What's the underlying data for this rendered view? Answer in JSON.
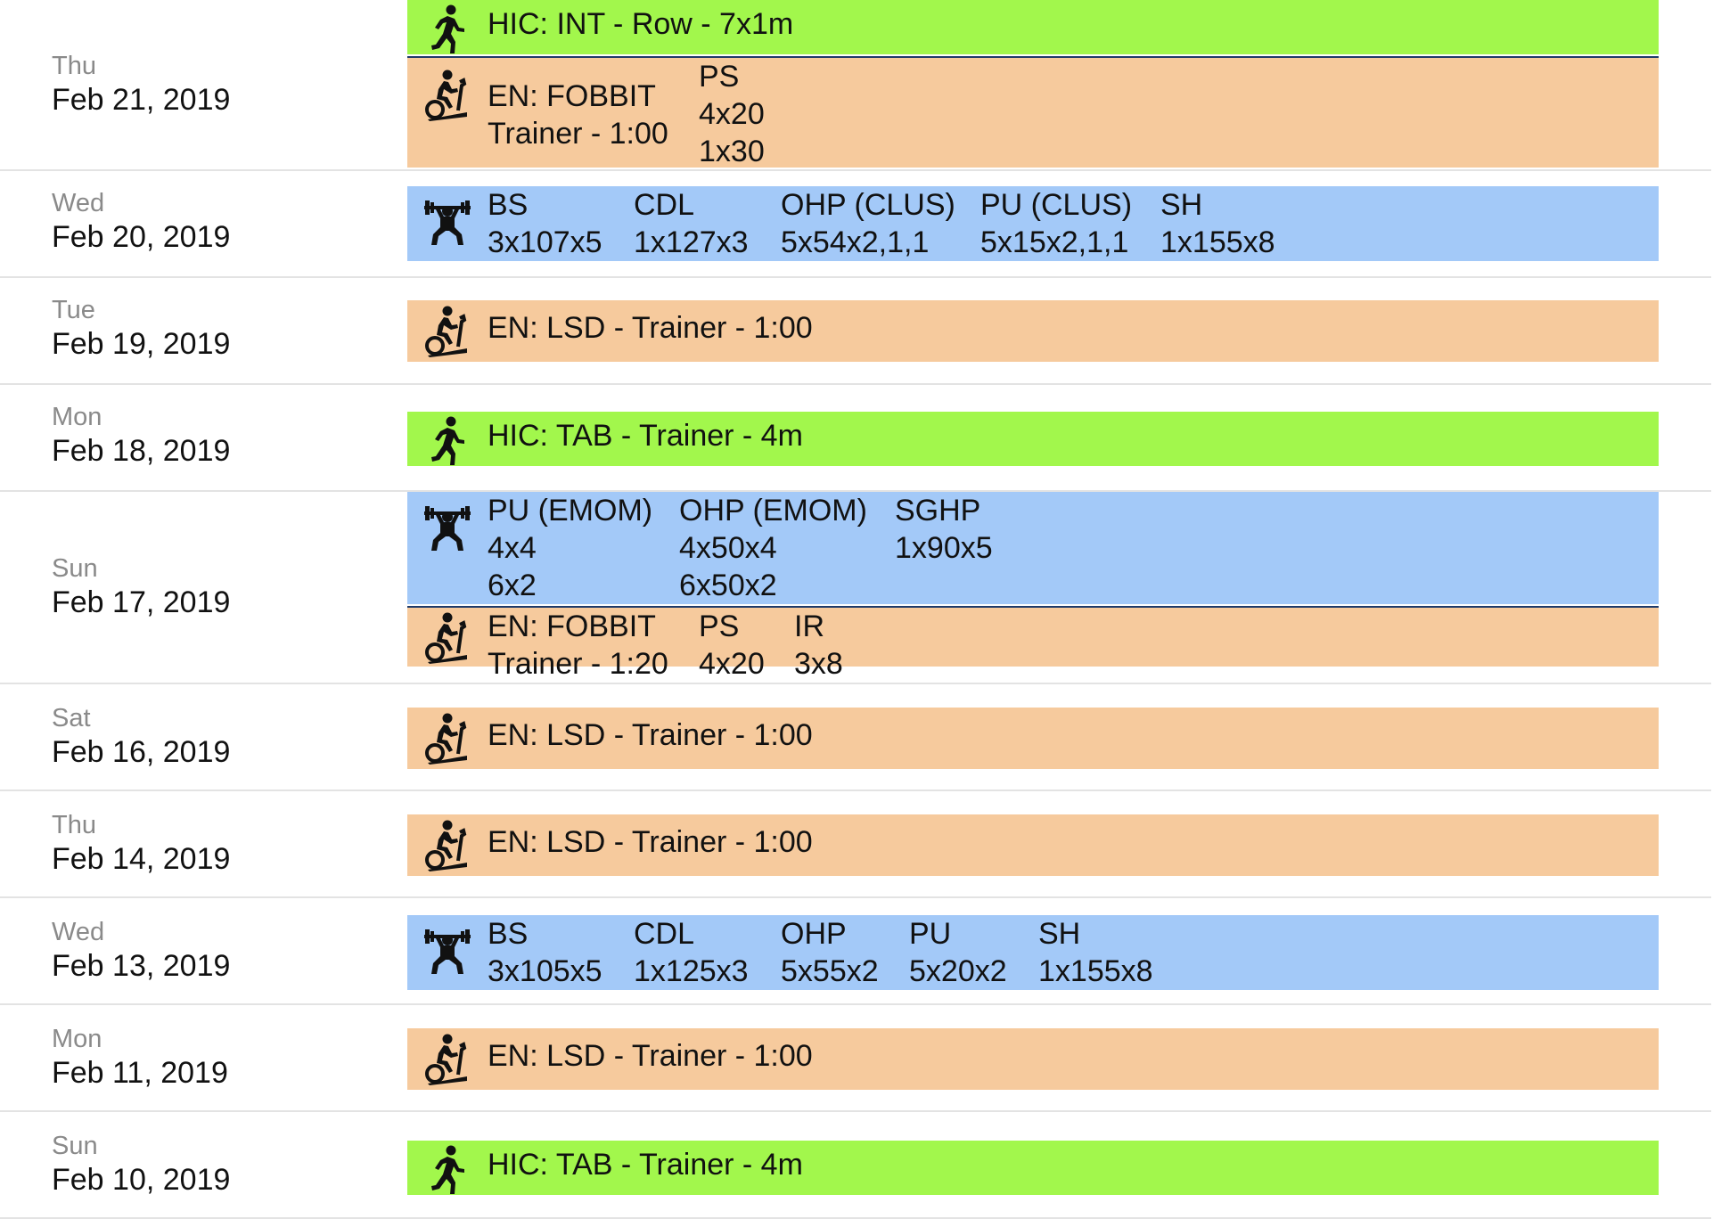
{
  "rows": [
    {
      "dow": "Thu",
      "date": "Feb 21, 2019",
      "blocks": [
        {
          "type": "green",
          "icon": "runner-icon",
          "text": "HIC: INT - Row - 7x1m"
        },
        {
          "type": "orange",
          "icon": "exercise-bike-icon",
          "cols": [
            {
              "lines": [
                "EN: FOBBIT",
                "Trainer - 1:00"
              ]
            },
            {
              "lines": [
                "PS",
                "4x20",
                "1x30"
              ]
            }
          ]
        }
      ]
    },
    {
      "dow": "Wed",
      "date": "Feb 20, 2019",
      "blocks": [
        {
          "type": "blue",
          "icon": "weightlifter-icon",
          "cols": [
            {
              "lines": [
                "BS",
                "3x107x5"
              ]
            },
            {
              "lines": [
                "CDL",
                "1x127x3"
              ]
            },
            {
              "lines": [
                "OHP (CLUS)",
                "5x54x2,1,1"
              ]
            },
            {
              "lines": [
                "PU (CLUS)",
                "5x15x2,1,1"
              ]
            },
            {
              "lines": [
                "SH",
                "1x155x8"
              ]
            }
          ]
        }
      ]
    },
    {
      "dow": "Tue",
      "date": "Feb 19, 2019",
      "blocks": [
        {
          "type": "orange",
          "icon": "exercise-bike-icon",
          "text": "EN: LSD - Trainer - 1:00"
        }
      ]
    },
    {
      "dow": "Mon",
      "date": "Feb 18, 2019",
      "blocks": [
        {
          "type": "green",
          "icon": "runner-icon",
          "text": "HIC: TAB - Trainer - 4m"
        }
      ]
    },
    {
      "dow": "Sun",
      "date": "Feb 17, 2019",
      "blocks": [
        {
          "type": "blue",
          "icon": "weightlifter-icon",
          "cols": [
            {
              "lines": [
                "PU (EMOM)",
                "4x4",
                "6x2"
              ]
            },
            {
              "lines": [
                "OHP (EMOM)",
                "4x50x4",
                "6x50x2"
              ]
            },
            {
              "lines": [
                "SGHP",
                "1x90x5"
              ]
            }
          ]
        },
        {
          "type": "orange",
          "icon": "exercise-bike-icon",
          "cols": [
            {
              "lines": [
                "EN: FOBBIT",
                "Trainer - 1:20"
              ]
            },
            {
              "lines": [
                "PS",
                "4x20"
              ]
            },
            {
              "lines": [
                "IR",
                "3x8"
              ]
            }
          ]
        }
      ]
    },
    {
      "dow": "Sat",
      "date": "Feb 16, 2019",
      "blocks": [
        {
          "type": "orange",
          "icon": "exercise-bike-icon",
          "text": "EN: LSD - Trainer - 1:00"
        }
      ]
    },
    {
      "dow": "Thu",
      "date": "Feb 14, 2019",
      "blocks": [
        {
          "type": "orange",
          "icon": "exercise-bike-icon",
          "text": "EN: LSD - Trainer - 1:00"
        }
      ]
    },
    {
      "dow": "Wed",
      "date": "Feb 13, 2019",
      "blocks": [
        {
          "type": "blue",
          "icon": "weightlifter-icon",
          "cols": [
            {
              "lines": [
                "BS",
                "3x105x5"
              ]
            },
            {
              "lines": [
                "CDL",
                "1x125x3"
              ]
            },
            {
              "lines": [
                "OHP",
                "5x55x2"
              ]
            },
            {
              "lines": [
                "PU",
                "5x20x2"
              ]
            },
            {
              "lines": [
                "SH",
                "1x155x8"
              ]
            }
          ]
        }
      ]
    },
    {
      "dow": "Mon",
      "date": "Feb 11, 2019",
      "blocks": [
        {
          "type": "orange",
          "icon": "exercise-bike-icon",
          "text": "EN: LSD - Trainer - 1:00"
        }
      ]
    },
    {
      "dow": "Sun",
      "date": "Feb 10, 2019",
      "blocks": [
        {
          "type": "green",
          "icon": "runner-icon",
          "text": "HIC: TAB - Trainer - 4m"
        }
      ]
    }
  ],
  "colors": {
    "green": "#a2f74c",
    "orange": "#f6ca9d",
    "blue": "#a3c9f8"
  }
}
